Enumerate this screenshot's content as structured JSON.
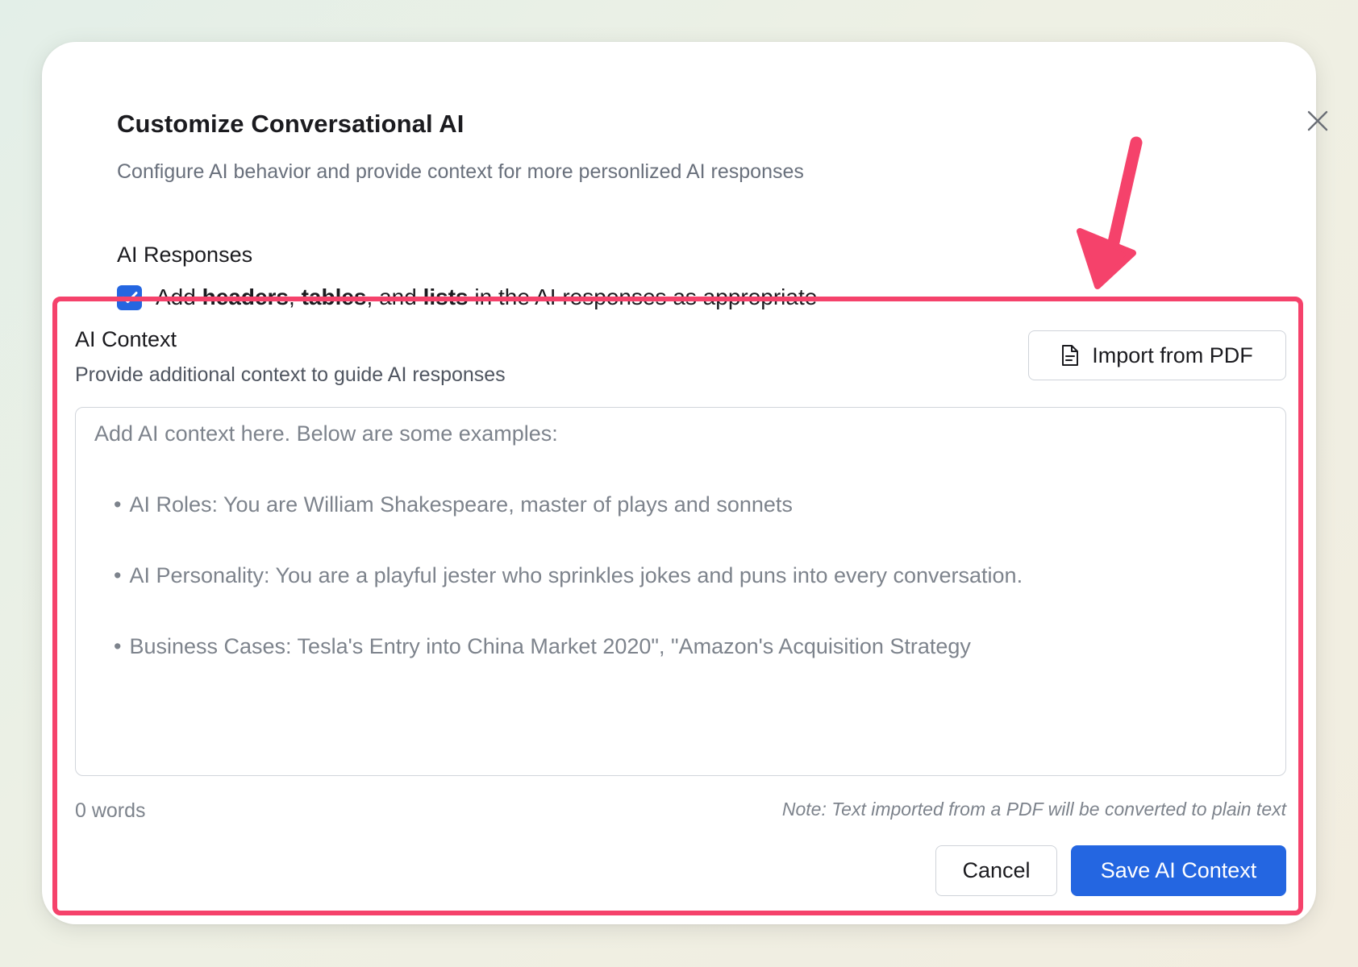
{
  "modal": {
    "title": "Customize Conversational AI",
    "subtitle": "Configure AI behavior and provide context for more personlized AI responses",
    "close_icon": "close-icon"
  },
  "ai_responses": {
    "label": "AI Responses",
    "checkbox_checked": true,
    "checkbox_text": {
      "part1": "Add ",
      "bold1": "headers",
      "part2": ", ",
      "bold2": "tables",
      "part3": ", and ",
      "bold3": "lists",
      "part4": " in the AI responses as appropriate"
    }
  },
  "ai_context": {
    "title": "AI Context",
    "subtitle": "Provide additional context to guide AI responses",
    "import_button": {
      "label": "Import from PDF",
      "icon": "file-icon"
    },
    "textarea": {
      "value": "",
      "placeholder_heading": "Add AI context here. Below are some examples:",
      "placeholder_examples": [
        "AI Roles: You are William Shakespeare, master of plays and sonnets",
        "AI Personality: You are a playful jester who sprinkles jokes and puns into every conversation.",
        "Business Cases: Tesla's Entry into China Market 2020\", \"Amazon's Acquisition Strategy"
      ],
      "bullet": "•"
    },
    "word_count": "0 words",
    "note": "Note: Text imported from a PDF will be converted to plain text",
    "cancel_label": "Cancel",
    "save_label": "Save AI Context"
  },
  "annotation": {
    "highlight_color": "#f5426b",
    "arrow_icon": "arrow-down-icon"
  },
  "colors": {
    "accent": "#2466e1",
    "text": "#1b1b1f",
    "muted": "#69707c"
  }
}
